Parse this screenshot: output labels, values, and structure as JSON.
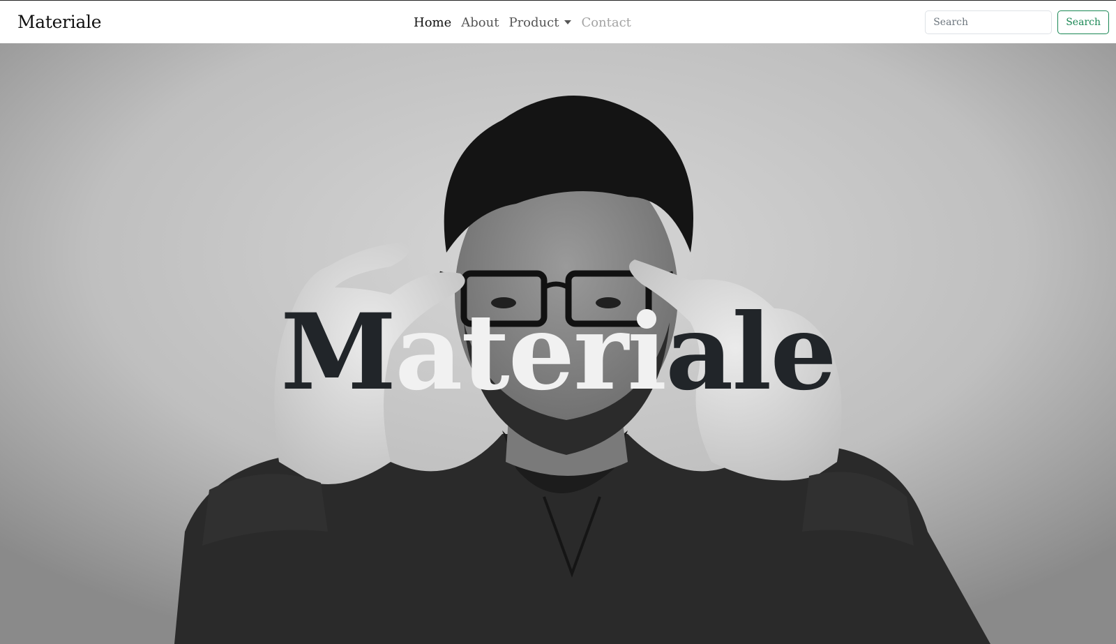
{
  "navbar": {
    "brand": "Materiale",
    "links": [
      {
        "label": "Home",
        "state": "active"
      },
      {
        "label": "About",
        "state": "default"
      },
      {
        "label": "Product",
        "state": "dropdown"
      },
      {
        "label": "Contact",
        "state": "disabled"
      }
    ],
    "search": {
      "placeholder": "Search",
      "button_label": "Search"
    }
  },
  "hero": {
    "title_parts": [
      "M",
      "ateri",
      "ale"
    ],
    "image_description": "black-and-white portrait photo"
  },
  "colors": {
    "accent": "#198754",
    "text_dark": "#212529",
    "text_light": "#f1f1f1"
  }
}
